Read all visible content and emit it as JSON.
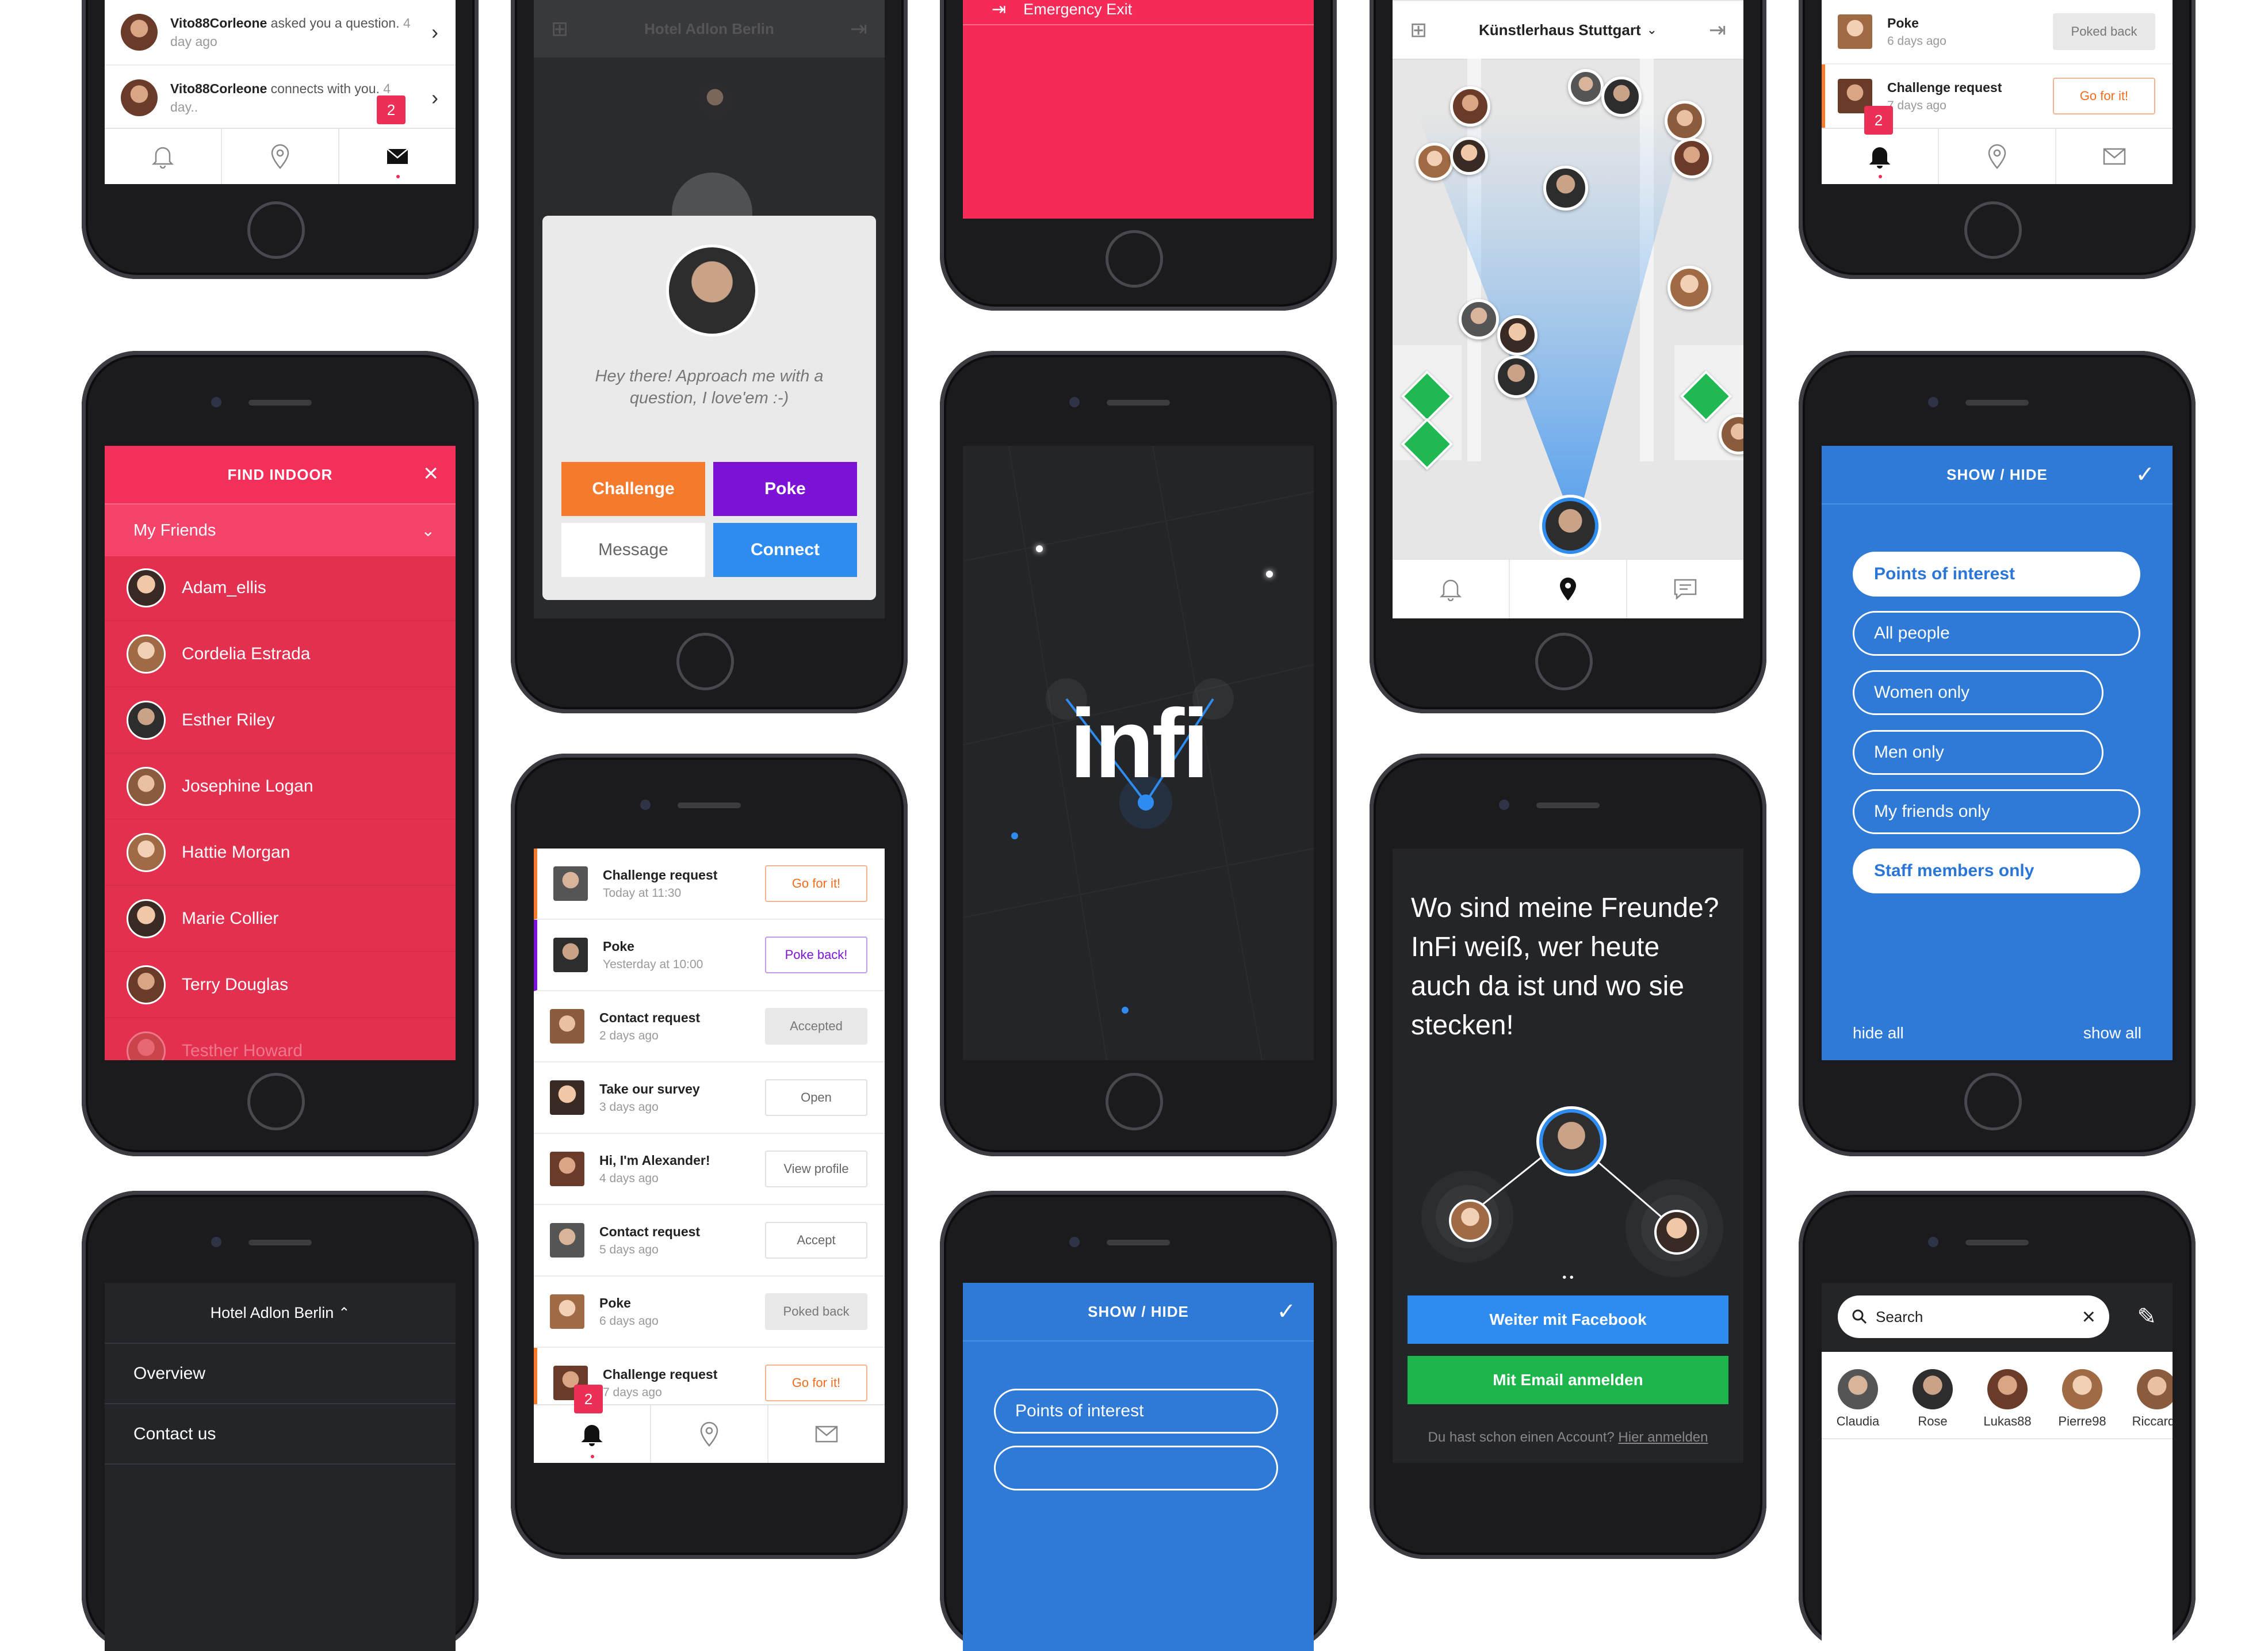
{
  "notifications_top": {
    "rows": [
      {
        "user": "Vito88Corleone",
        "text": " asked you a question.",
        "time": "4 day ago"
      },
      {
        "user": "Vito88Corleone",
        "text": " connects with you.",
        "time": "4 day.."
      }
    ],
    "badge": "2"
  },
  "find_indoor": {
    "title": "FIND INDOOR",
    "filter": "My Friends",
    "friends": [
      "Adam_ellis",
      "Cordelia Estrada",
      "Esther Riley",
      "Josephine Logan",
      "Hattie Morgan",
      "Marie Collier",
      "Terry Douglas",
      "Testher Howard"
    ]
  },
  "venue_menu": {
    "title": "Hotel Adlon Berlin",
    "items": [
      "Overview",
      "Contact us"
    ]
  },
  "profile_popup": {
    "header": "Hotel Adlon Berlin",
    "message": "Hey there! Approach me with a question, I love'em :-)",
    "buttons": {
      "challenge": "Challenge",
      "poke": "Poke",
      "message": "Message",
      "connect": "Connect"
    }
  },
  "activity": {
    "badge": "2",
    "rows": [
      {
        "title": "Challenge request",
        "time": "Today at 11:30",
        "action": "Go for it!"
      },
      {
        "title": "Poke",
        "time": "Yesterday at 10:00",
        "action": "Poke back!"
      },
      {
        "title": "Contact request",
        "time": "2 days ago",
        "action": "Accepted"
      },
      {
        "title": "Take our survey",
        "time": "3 days ago",
        "action": "Open"
      },
      {
        "title": "Hi, I'm Alexander!",
        "time": "4 days ago",
        "action": "View profile"
      },
      {
        "title": "Contact request",
        "time": "5 days ago",
        "action": "Accept"
      },
      {
        "title": "Poke",
        "time": "6 days ago",
        "action": "Poked back"
      },
      {
        "title": "Challenge request",
        "time": "7 days ago",
        "action": "Go for it!"
      }
    ]
  },
  "emergency": {
    "label": "Emergency Exit",
    "accent": "#f52a57"
  },
  "splash": {
    "logo": "infi"
  },
  "show_hide_small": {
    "title": "SHOW / HIDE",
    "first_option": "Points of interest"
  },
  "map_view": {
    "venue": "Künstlerhaus Stuttgart"
  },
  "onboarding": {
    "headline": "Wo sind meine Freunde? InFi weiß, wer heute auch da ist und wo sie stecken!",
    "facebook_button": "Weiter mit Facebook",
    "email_button": "Mit Email anmelden",
    "account_prompt": "Du hast schon einen Account?",
    "login_link": "Hier anmelden"
  },
  "notifications_right": {
    "badge": "2",
    "rows": [
      {
        "title": "Poke",
        "time": "6 days ago",
        "action": "Poked back"
      },
      {
        "title": "Challenge request",
        "time": "7 days ago",
        "action": "Go for it!"
      }
    ]
  },
  "show_hide_large": {
    "title": "SHOW / HIDE",
    "options": [
      "Points of interest",
      "All people",
      "Women only",
      "Men only",
      "My friends only",
      "Staff members only"
    ],
    "hide_all": "hide all",
    "show_all": "show all",
    "accent": "#2e7ad6"
  },
  "contacts_search": {
    "placeholder": "Search",
    "contacts": [
      "Claudia",
      "Rose",
      "Lukas88",
      "Pierre98",
      "Riccardo"
    ]
  }
}
